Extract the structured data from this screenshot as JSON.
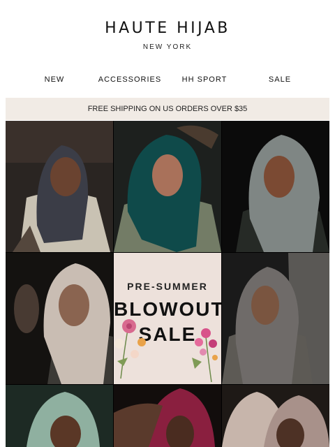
{
  "header": {
    "brand": "HAUTE HIJAB",
    "sub": "NEW YORK"
  },
  "nav": {
    "items": [
      {
        "label": "NEW"
      },
      {
        "label": "ACCESSORIES"
      },
      {
        "label": "HH SPORT"
      },
      {
        "label": "SALE"
      }
    ]
  },
  "banner": {
    "text": "FREE SHIPPING ON US ORDERS OVER $35"
  },
  "promo": {
    "line1": "PRE-SUMMER",
    "line2": "BLOWOUT",
    "line3": "SALE"
  },
  "colors": {
    "banner_bg": "#f1ebe5",
    "promo_bg": "#ede1db"
  }
}
